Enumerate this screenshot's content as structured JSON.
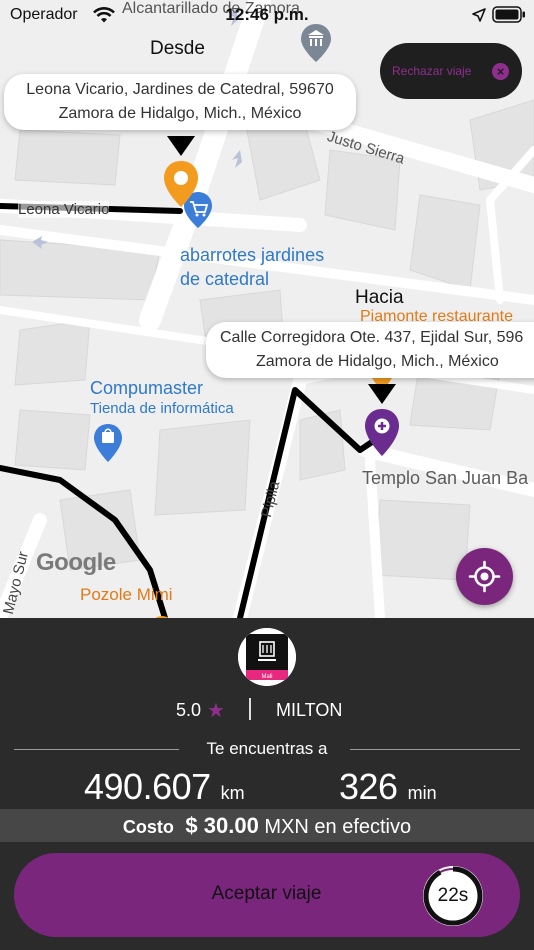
{
  "status_bar": {
    "carrier": "Operador",
    "time": "12:46 p.m."
  },
  "map": {
    "labels": {
      "top_street": "Alcantarillado de Zamora",
      "leona_vicario": "Leona Vicario",
      "justo_sierra": "Justo Sierra",
      "poi_abarrotes_line1": "abarrotes jardines",
      "poi_abarrotes_line2": "de catedral",
      "poi_piamonte": "Piamonte restaurante",
      "poi_compumaster": "Compumaster",
      "poi_compumaster_sub": "Tienda de informática",
      "poi_templo": "Templo San Juan Ba",
      "pipila": "Pipila",
      "mayo_sur": "Mayo Sur",
      "poi_pozole": "Pozole Mimi",
      "google": "Google"
    },
    "origin": {
      "title": "Desde",
      "address_line1": "Leona Vicario, Jardines de Catedral, 59670",
      "address_line2": "Zamora de Hidalgo, Mich., México"
    },
    "destination": {
      "title": "Hacia",
      "address_line1": "Calle Corregidora Ote. 437, Ejidal Sur, 596",
      "address_line2": "Zamora de Hidalgo, Mich., México"
    },
    "route_color": "#000000"
  },
  "reject_button": {
    "label": "Rechazar viaje"
  },
  "driver": {
    "avatar_text": "Mali",
    "rating": "5.0",
    "name": "MILTON"
  },
  "trip": {
    "heading": "Te encuentras a",
    "distance_value": "490.607",
    "distance_unit": "km",
    "duration_value": "326",
    "duration_unit": "min"
  },
  "cost": {
    "label": "Costo",
    "amount": "$ 30.00",
    "suffix": "MXN en efectivo"
  },
  "accept_button": {
    "label": "Aceptar viaje",
    "timer": "22s",
    "timer_progress": 0.92
  },
  "colors": {
    "accent": "#7b267d",
    "panel": "#2b2b2b",
    "origin_pin": "#f39b1e",
    "destination_pin": "#6a2c8f"
  }
}
